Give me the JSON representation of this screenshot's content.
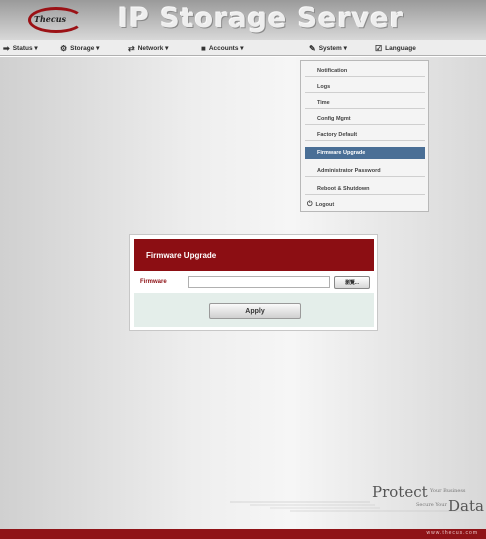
{
  "header": {
    "brand": "Thecus",
    "title": "IP Storage Server"
  },
  "menubar": {
    "items": [
      {
        "icon": "status-icon",
        "glyph": "➡",
        "label": "Status ▾"
      },
      {
        "icon": "storage-icon",
        "glyph": "⚙",
        "label": "Storage ▾"
      },
      {
        "icon": "network-icon",
        "glyph": "⇄",
        "label": "Network ▾"
      },
      {
        "icon": "accounts-icon",
        "glyph": "■",
        "label": "Accounts ▾"
      },
      {
        "icon": "system-icon",
        "glyph": "✎",
        "label": "System ▾"
      },
      {
        "icon": "language-icon",
        "glyph": "☑",
        "label": "Language"
      }
    ]
  },
  "system_menu": {
    "items": [
      {
        "label": "Notification"
      },
      {
        "label": "Logs"
      },
      {
        "label": "Time"
      },
      {
        "label": "Config Mgmt"
      },
      {
        "label": "Factory Default"
      },
      {
        "label": "Firmware Upgrade",
        "active": true
      },
      {
        "label": "Administrator Password"
      },
      {
        "label": "Reboot & Shutdown"
      }
    ],
    "logout": {
      "icon": "logout-icon",
      "glyph": "⏻",
      "label": "Logout"
    }
  },
  "dialog": {
    "title": "Firmware Upgrade",
    "field_label": "Firmware",
    "field_value": "",
    "browse_label": "瀏覽...",
    "apply_label": "Apply"
  },
  "slogan": {
    "protect": "Protect",
    "your_business": "Your Business",
    "secure_your": "Secure Your",
    "data": "Data"
  },
  "footer": {
    "url": "www.thecus.com"
  },
  "colors": {
    "brand_red": "#8c0e13",
    "menu_active": "#4a6f96"
  }
}
